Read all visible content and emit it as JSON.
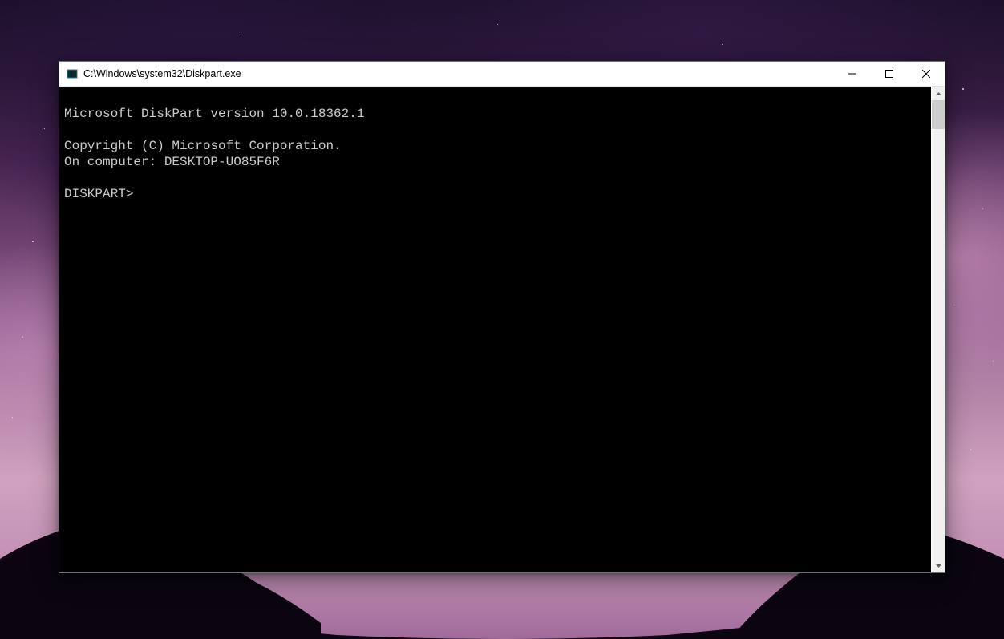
{
  "window": {
    "title": "C:\\Windows\\system32\\Diskpart.exe"
  },
  "console": {
    "lines": [
      "",
      "Microsoft DiskPart version 10.0.18362.1",
      "",
      "Copyright (C) Microsoft Corporation.",
      "On computer: DESKTOP-UO85F6R",
      "",
      "DISKPART>"
    ]
  },
  "icons": {
    "app": "console-icon",
    "minimize": "minimize-icon",
    "maximize": "maximize-icon",
    "close": "close-icon",
    "scroll_up": "chevron-up-icon",
    "scroll_down": "chevron-down-icon"
  }
}
